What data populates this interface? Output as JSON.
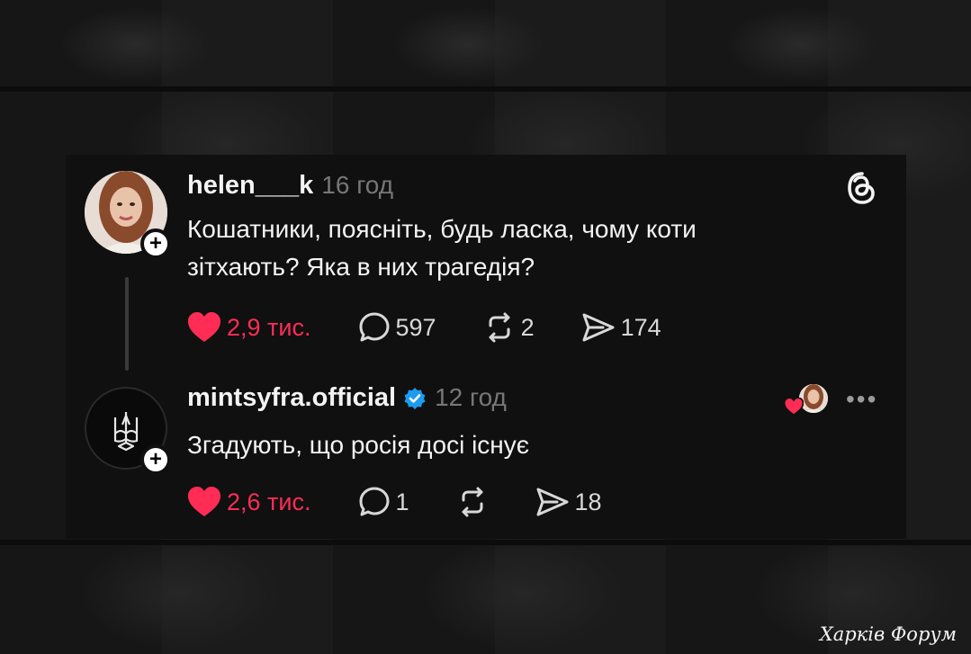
{
  "posts": [
    {
      "username": "helen___k",
      "time": "16 год",
      "text_line1": "Кошатники, поясніть, будь ласка, чому коти",
      "text_line2": "зітхають? Яка в них трагедія?",
      "likes": "2,9 тис.",
      "comments": "597",
      "reposts": "2",
      "shares": "174",
      "avatar_icon": "user-photo",
      "follow_icon": "plus-icon"
    },
    {
      "username": "mintsyfra.official",
      "verified": true,
      "time": "12 год",
      "text": "Згадують, що росія досі існує",
      "likes": "2,6 тис.",
      "comments": "1",
      "reposts": "",
      "shares": "18",
      "avatar_icon": "trident-icon",
      "follow_icon": "plus-icon",
      "liked_by_author": true,
      "more_label": "•••"
    }
  ],
  "app_icon": "threads-icon",
  "watermark": "Харків Форум",
  "colors": {
    "card_bg": "#101010",
    "like": "#ff2d55",
    "verified": "#1d9bf0",
    "muted": "#777777",
    "text": "#f3f3f3"
  }
}
